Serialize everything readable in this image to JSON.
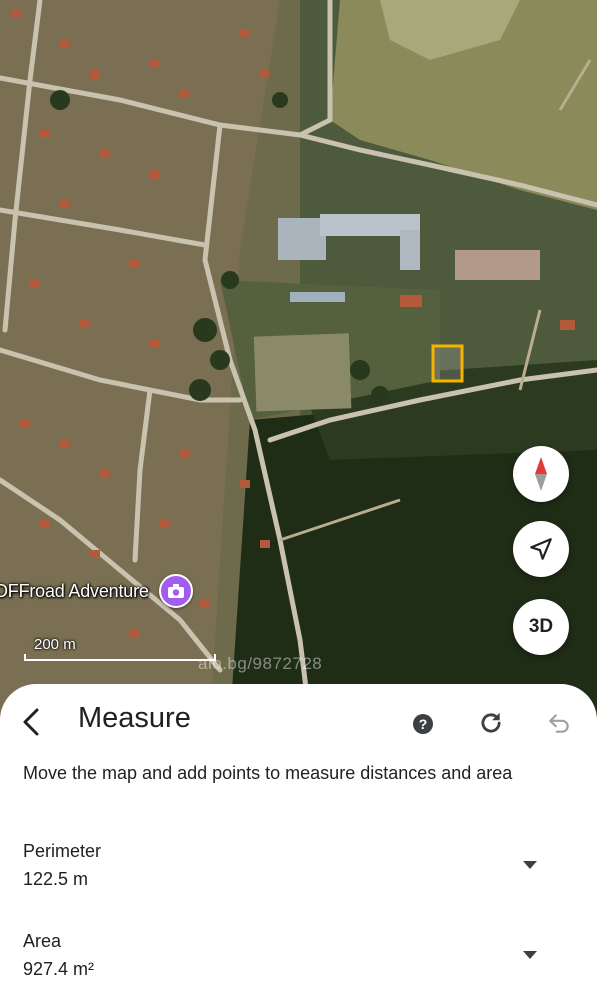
{
  "map": {
    "poi_label": "OFFroad Adventure",
    "scale_label": "200 m",
    "watermark": "alo.bg/9872728",
    "controls": {
      "compass_icon": "compass-icon",
      "locate_icon": "navigation-arrow-icon",
      "three_d_label": "3D"
    },
    "measure_outline_color": "#f4b400"
  },
  "sheet": {
    "title": "Measure",
    "instructions": "Move the map and add points to measure distances and area",
    "metrics": [
      {
        "label": "Perimeter",
        "value": "122.5 m"
      },
      {
        "label": "Area",
        "value": "927.4 m²"
      }
    ],
    "icons": {
      "back": "back-arrow-icon",
      "help": "help-icon",
      "reset": "refresh-icon",
      "undo": "undo-icon"
    }
  }
}
